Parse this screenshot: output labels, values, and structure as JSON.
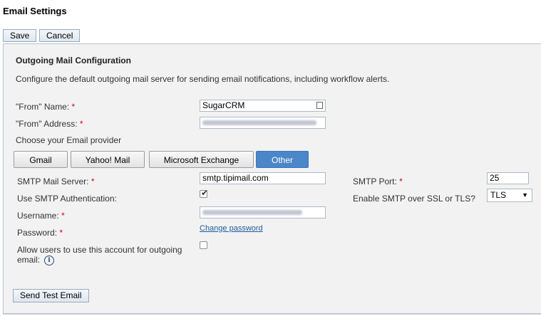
{
  "page": {
    "title": "Email Settings"
  },
  "toolbar": {
    "save_label": "Save",
    "cancel_label": "Cancel"
  },
  "section": {
    "title": "Outgoing Mail Configuration",
    "description": "Configure the default outgoing mail server for sending email notifications, including workflow alerts."
  },
  "from_name": {
    "label": "\"From\" Name:",
    "required": "*",
    "value": "SugarCRM"
  },
  "from_address": {
    "label": "\"From\" Address:",
    "required": "*"
  },
  "provider": {
    "label": "Choose your Email provider",
    "tabs": [
      "Gmail",
      "Yahoo! Mail",
      "Microsoft Exchange",
      "Other"
    ],
    "selected": "Other"
  },
  "smtp_server": {
    "label": "SMTP Mail Server:",
    "required": "*",
    "value": "smtp.tipimail.com"
  },
  "smtp_auth": {
    "label": "Use SMTP Authentication:",
    "checked": true
  },
  "username": {
    "label": "Username:",
    "required": "*"
  },
  "password": {
    "label": "Password:",
    "required": "*",
    "change_link": "Change password"
  },
  "allow_users": {
    "label": "Allow users to use this account for outgoing email:",
    "checked": false
  },
  "smtp_port": {
    "label": "SMTP Port:",
    "required": "*",
    "value": "25"
  },
  "smtp_ssl": {
    "label": "Enable SMTP over SSL or TLS?",
    "value": "TLS"
  },
  "test_button": {
    "label": "Send Test Email"
  },
  "icons": {
    "contact": "address-book-icon",
    "info": "info-icon",
    "checkmark": "checkmark-icon",
    "dropdown": "dropdown-arrow-icon"
  },
  "colors": {
    "accent": "#4b86c9",
    "required": "#dd0000",
    "link": "#1a5d9a",
    "panel_bg": "#f2f2f2"
  }
}
